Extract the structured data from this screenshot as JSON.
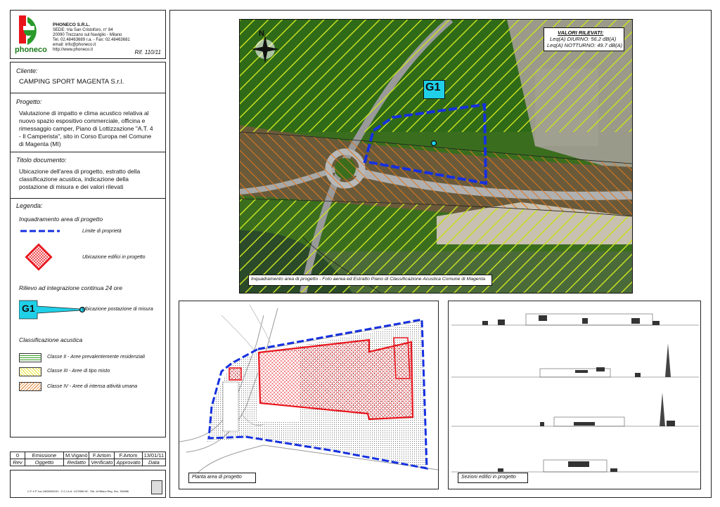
{
  "company": {
    "logo_text": "phoneco",
    "name": "PHONECO S.R.L.",
    "lines": [
      "SEDE: Via San Cristoforo, n° 84",
      "20090 Trezzano sul Naviglio - Milano",
      "Tel. 02.48463689 r.a. - Fax: 02.48463681",
      "email: info@phoneco.it",
      "http://www.phoneco.it"
    ],
    "ref": "Rif. 110/11"
  },
  "cliente": {
    "label": "Cliente:",
    "value": "CAMPING SPORT MAGENTA S.r.l."
  },
  "progetto": {
    "label": "Progetto:",
    "lines": [
      "Valutazione di impatto e clima acustico relativa al",
      "nuovo spazio espositivo commerciale, officina e",
      "rimessaggio camper, Piano di Lottizzazione \"A.T. 4",
      "- Il Camperista\", sito in Corso Europa nel Comune",
      "di Magenta (MI)"
    ]
  },
  "titolo": {
    "label": "Titolo documento:",
    "lines": [
      "Ubicazione dell'area di progetto, estratto della",
      "classificazione acustica, indicazione della",
      "postazione di misura e dei valori rilevati"
    ]
  },
  "legenda": {
    "label": "Legenda:",
    "sec1": "Inquadramento area di progetto",
    "limite": "Limite di proprietà",
    "edifici": "Ubicazione edifici in progetto",
    "sec2": "Rilievo ad integrazione continua 24 ore",
    "g1": "G1",
    "postazione": "Ubicazione postazione di misura",
    "sec3": "Classificazione acustica",
    "classe2": "Classe II - Aree prevalentemente residenziali",
    "classe3": "Classe III - Aree di tipo misto",
    "classe4": "Classe IV - Aree di intensa attività umana"
  },
  "revision": {
    "row": [
      "0",
      "Emissione",
      "M.Viganò",
      "F.Artom",
      "F.Artom",
      "13/01/11"
    ],
    "head": [
      "Rev",
      "Oggetto",
      "Redatto",
      "Verificato",
      "Approvato",
      "Data"
    ]
  },
  "footer": {
    "text": "C.F. e P. Iva 11626630151 - C.C.I.A.A. 1472066 MI - Trib. di Milano Reg. Soc. 354086"
  },
  "map": {
    "north": "N",
    "valori_title": "VALORI RILEVATI:",
    "diurno": "Leq(A) DIURNO: 56.2 dB(A)",
    "notturno": "Leq(A) NOTTURNO: 49.7 dB(A)",
    "g1": "G1",
    "caption": "Inquadramento area di progetto - Foto aerea ed Estratto Piano di Classificazione Acustica Comune di Magenta"
  },
  "planta": {
    "caption": "Planta area di progetto"
  },
  "sezioni": {
    "caption": "Sezioni edifici in progetto"
  },
  "colors": {
    "blue": "#1530e0",
    "red": "#e8141c",
    "cyan": "#1fd0e8",
    "hatch_green": "#2e7d1a",
    "hatch_orange": "#e07820",
    "hatch_yellow": "#e8e020"
  }
}
